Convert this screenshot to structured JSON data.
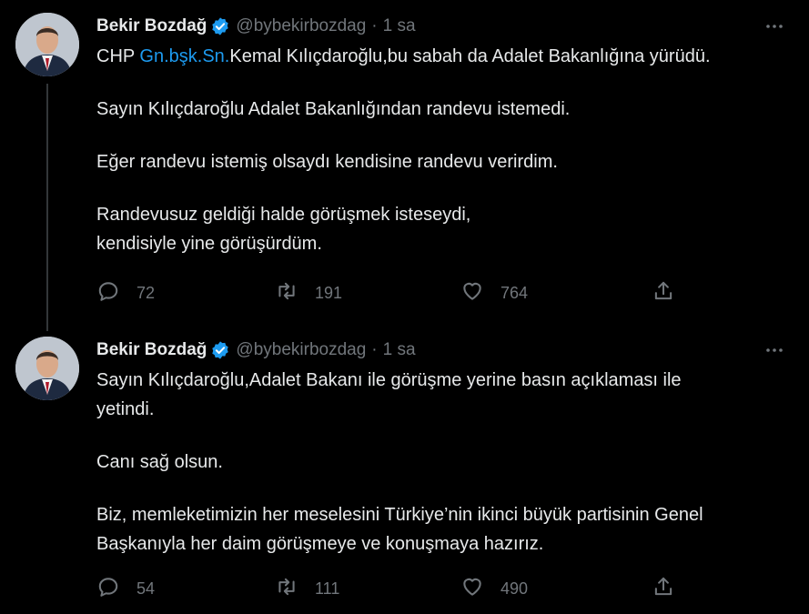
{
  "tweets": [
    {
      "author": "Bekir Bozdağ",
      "handle": "@bybekirbozdag",
      "separator": "·",
      "time": "1 sa",
      "text": {
        "l1_prefix": "CHP ",
        "l1_link": "Gn.bşk.Sn.",
        "l1_suffix": "Kemal Kılıçdaroğlu,bu sabah da Adalet Bakanlığına yürüdü.",
        "p2": "Sayın Kılıçdaroğlu Adalet Bakanlığından randevu istemedi.",
        "p3": "Eğer randevu istemiş olsaydı kendisine randevu verirdim.",
        "p4_l1": "Randevusuz geldiği halde görüşmek isteseydi,",
        "p4_l2": "kendisiyle yine görüşürdüm."
      },
      "stats": {
        "replies": "72",
        "retweets": "191",
        "likes": "764"
      }
    },
    {
      "author": "Bekir Bozdağ",
      "handle": "@bybekirbozdag",
      "separator": "·",
      "time": "1 sa",
      "text": {
        "p1_l1": "Sayın Kılıçdaroğlu,Adalet Bakanı ile görüşme yerine basın açıklaması ile",
        "p1_l2": "yetindi.",
        "p2": "Canı sağ olsun.",
        "p3_l1": "Biz, memleketimizin her meselesini Türkiye’nin ikinci büyük partisinin Genel",
        "p3_l2": "Başkanıyla her daim görüşmeye ve konuşmaya hazırız."
      },
      "stats": {
        "replies": "54",
        "retweets": "111",
        "likes": "490"
      }
    }
  ],
  "icons": {
    "verified": "verified-badge-icon",
    "more": "more-dots-icon",
    "reply": "reply-icon",
    "retweet": "retweet-icon",
    "like": "heart-icon",
    "share": "share-icon"
  },
  "colors": {
    "background": "#000000",
    "text": "#e7e9ea",
    "muted": "#71767b",
    "accent": "#1d9bf0"
  }
}
